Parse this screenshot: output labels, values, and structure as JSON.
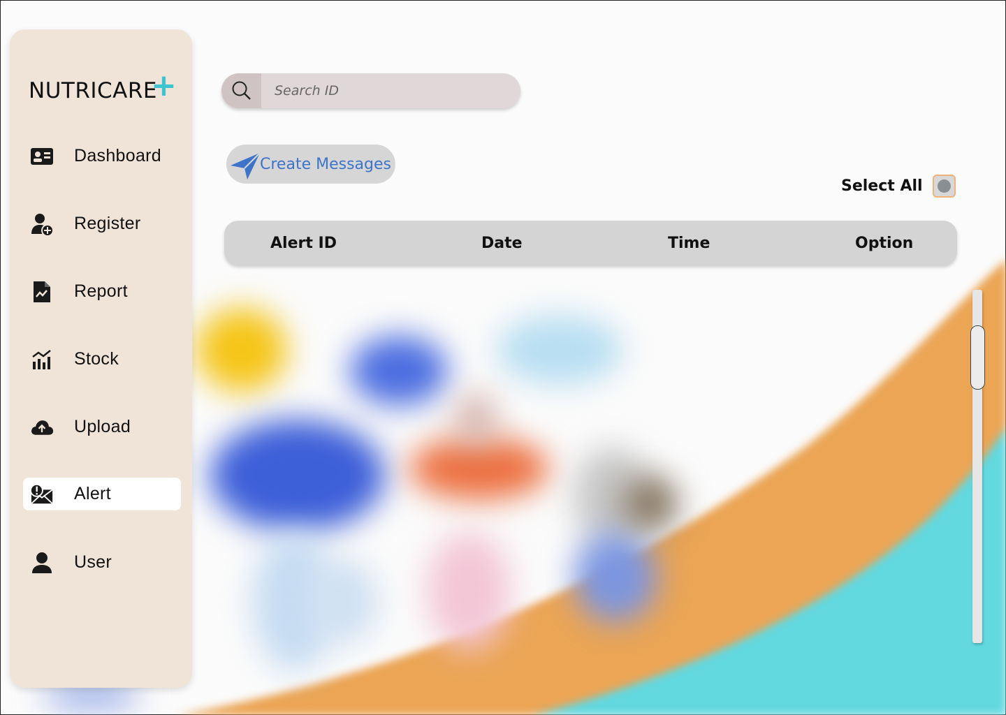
{
  "app": {
    "logo_text": "NUTRICARE",
    "logo_mark": "+",
    "accent_color": "#3ec4cf"
  },
  "sidebar": {
    "items": [
      {
        "label": "Dashboard",
        "icon": "id-card-icon",
        "active": false
      },
      {
        "label": "Register",
        "icon": "add-user-icon",
        "active": false
      },
      {
        "label": "Report",
        "icon": "report-file-icon",
        "active": false
      },
      {
        "label": "Stock",
        "icon": "bar-chart-icon",
        "active": false
      },
      {
        "label": "Upload",
        "icon": "cloud-upload-icon",
        "active": false
      },
      {
        "label": "Alert",
        "icon": "alert-mail-icon",
        "active": true
      },
      {
        "label": "User",
        "icon": "user-icon",
        "active": false
      }
    ]
  },
  "search": {
    "placeholder": "Search ID",
    "value": ""
  },
  "actions": {
    "create_messages_label": "Create Messages",
    "create_messages_color": "#3d73c9",
    "select_all_label": "Select All",
    "select_all_checked": false
  },
  "table": {
    "columns": [
      "Alert ID",
      "Date",
      "Time",
      "Option"
    ],
    "rows": []
  }
}
